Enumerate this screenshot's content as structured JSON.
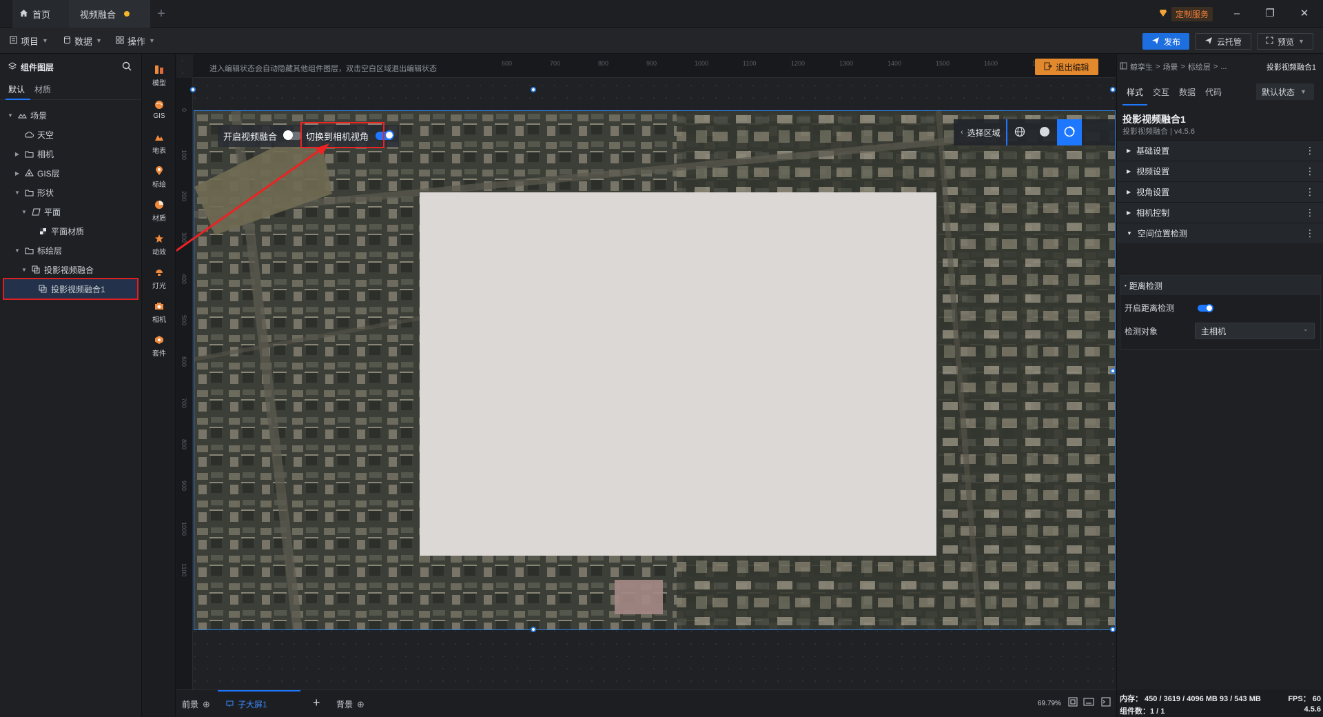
{
  "tabs": {
    "home": "首页",
    "active": "视频融合"
  },
  "titlebar": {
    "custom_service": "定制服务"
  },
  "toolbar": {
    "project": "项目",
    "data": "数据",
    "operate": "操作",
    "publish": "发布",
    "cloud": "云托管",
    "preview": "预览"
  },
  "left_panel": {
    "title": "组件图层",
    "tab_default": "默认",
    "tab_material": "材质",
    "tree": [
      {
        "label": "场景",
        "indent": 0,
        "expanded": true,
        "icon": "scene-icon"
      },
      {
        "label": "天空",
        "indent": 1,
        "icon": "sky-icon"
      },
      {
        "label": "相机",
        "indent": 1,
        "collapsed": true,
        "icon": "folder-icon"
      },
      {
        "label": "GIS层",
        "indent": 1,
        "collapsed": true,
        "icon": "gis-layer-icon"
      },
      {
        "label": "形状",
        "indent": 1,
        "expanded": true,
        "icon": "folder-icon"
      },
      {
        "label": "平面",
        "indent": 2,
        "expanded": true,
        "icon": "plane-icon"
      },
      {
        "label": "平面材质",
        "indent": 3,
        "icon": "material-icon"
      },
      {
        "label": "标绘层",
        "indent": 1,
        "expanded": true,
        "icon": "folder-icon"
      },
      {
        "label": "投影视频融合",
        "indent": 2,
        "expanded": true,
        "icon": "group-icon"
      },
      {
        "label": "投影视频融合1",
        "indent": 3,
        "icon": "group-icon",
        "selected": true
      }
    ]
  },
  "rail": [
    {
      "label": "模型",
      "icon": "model-icon",
      "color": "#f08a3c"
    },
    {
      "label": "GIS",
      "icon": "gis-icon",
      "color": "#f08a3c"
    },
    {
      "label": "地表",
      "icon": "terrain-icon",
      "color": "#f08a3c"
    },
    {
      "label": "标绘",
      "icon": "pin-icon",
      "color": "#f08a3c"
    },
    {
      "label": "材质",
      "icon": "material-ball-icon",
      "color": "#f08a3c"
    },
    {
      "label": "动效",
      "icon": "effect-icon",
      "color": "#f08a3c"
    },
    {
      "label": "灯光",
      "icon": "light-icon",
      "color": "#f08a3c"
    },
    {
      "label": "相机",
      "icon": "camera-icon",
      "color": "#f08a3c"
    },
    {
      "label": "套件",
      "icon": "kit-icon",
      "color": "#f08a3c"
    }
  ],
  "canvas": {
    "hint": "进入编辑状态会自动隐藏其他组件图层，双击空白区域退出编辑状态",
    "exit_edit": "退出编辑",
    "ruler_top": [
      "600",
      "700",
      "800",
      "900",
      "1000",
      "1100",
      "1200",
      "1300",
      "1400",
      "1500",
      "1600",
      "1700",
      "1800",
      "1900"
    ],
    "ruler_left": [
      "0",
      "100",
      "200",
      "300",
      "400",
      "500",
      "600",
      "700",
      "800",
      "900",
      "1000",
      "1100"
    ],
    "toggle_fusion": "开启视频融合",
    "toggle_fusion_on": false,
    "toggle_camera": "切换到相机视角",
    "toggle_camera_on": true,
    "select_area": "选择区域"
  },
  "bottom": {
    "front": "前景",
    "sub_screen": "子大屏1",
    "background": "背景",
    "zoom": "69.79%"
  },
  "right_panel": {
    "breadcrumb": [
      "鲸孪生",
      "场景",
      "标绘层",
      "..."
    ],
    "breadcrumb_current": "投影视频融合1",
    "tabs": [
      "样式",
      "交互",
      "数据",
      "代码"
    ],
    "state": "默认状态",
    "component_name": "投影视频融合1",
    "component_sub": "投影视频融合 | v4.5.6",
    "sections": [
      "基础设置",
      "视频设置",
      "视角设置",
      "相机控制",
      "空间位置检测"
    ],
    "distance_title": "距离检测",
    "enable_distance": "开启距离检测",
    "enable_distance_on": true,
    "detect_target_label": "检测对象",
    "detect_target_value": "主相机",
    "stats_line1_left": "内存：  450 / 3619 / 4096 MB  93 / 543 MB",
    "stats_line1_right": "FPS：  60",
    "stats_line2_left": "组件数：1 / 1",
    "stats_line2_right": "4.5.6"
  },
  "colors": {
    "accent": "#1e78ff",
    "warning": "#e2882d",
    "highlight": "#e22222"
  }
}
